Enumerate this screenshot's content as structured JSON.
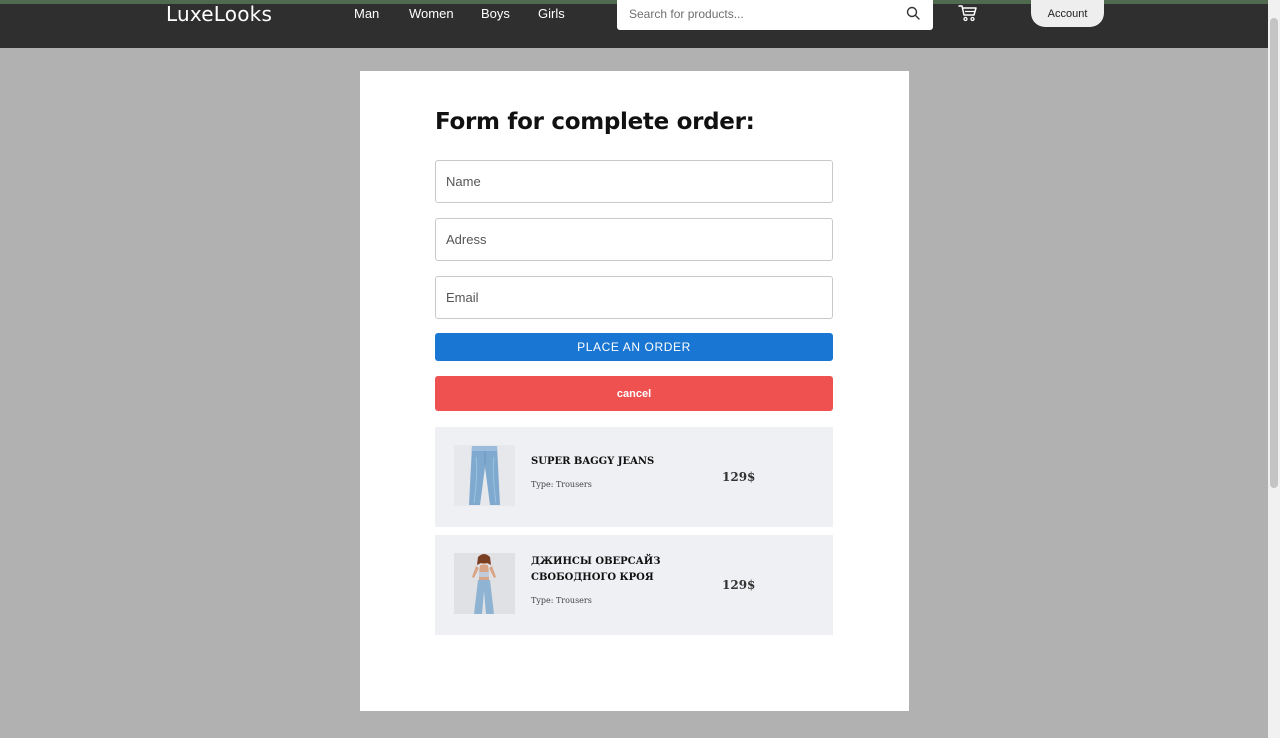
{
  "header": {
    "logo": "LuxeLooks",
    "nav": [
      "Man",
      "Women",
      "Boys",
      "Girls"
    ],
    "search_placeholder": "Search for products...",
    "account_label": "Account"
  },
  "form": {
    "title": "Form for complete order:",
    "name_placeholder": "Name",
    "address_placeholder": "Adress",
    "email_placeholder": "Email",
    "place_order_label": "PLACE AN ORDER",
    "cancel_label": "cancel"
  },
  "order_items": [
    {
      "name": "SUPER BAGGY JEANS",
      "type": "Type: Trousers",
      "price": "129$"
    },
    {
      "name": "ДЖИНСЫ ОВЕРСАЙЗ СВОБОДНОГО КРОЯ",
      "type": "Type: Trousers",
      "price": "129$"
    }
  ],
  "colors": {
    "header_bg": "#2f2f2f",
    "page_overlay": "#b1b1b1",
    "primary": "#1976d2",
    "danger": "#ef5050"
  },
  "icons": [
    "search-icon",
    "cart-icon"
  ]
}
